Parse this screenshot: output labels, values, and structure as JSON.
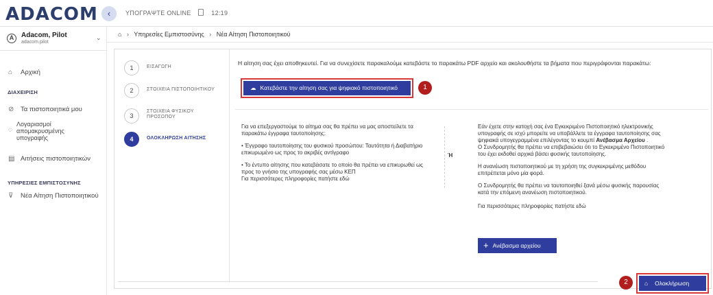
{
  "header": {
    "logo": "ADACOM",
    "collapse_icon": "chevron-left-icon",
    "collapse_glyph": "‹",
    "app_name": "ΥΠΟΓΡΑΨΤΕ ONLINE",
    "time": "12:19"
  },
  "user": {
    "name": "Adacom, Pilot",
    "login": "adacom.pilot",
    "avatar_glyph": "A"
  },
  "sidebar": {
    "home": "Αρχική",
    "section_manage": "ΔΙΑΧΕΙΡΙΣΗ",
    "my_certificates": "Τα πιστοποιητικά μου",
    "remote_accounts": "Λογαριασμοί απομακρυσμένης υπογραφής",
    "certificate_requests": "Αιτήσεις πιστοποιητικών",
    "section_trust": "ΥΠΗΡΕΣΙΕΣ ΕΜΠΙΣΤΟΣΥΝΗΣ",
    "new_request": "Νέα Αίτηση Πιστοποιητικού"
  },
  "breadcrumb": {
    "items": [
      "Υπηρεσίες Εμπιστοσύνης",
      "Νέα Αίτηση Πιστοποιητικού"
    ]
  },
  "steps": [
    {
      "num": "1",
      "label": "ΕΙΣΑΓΩΓΗ"
    },
    {
      "num": "2",
      "label": "ΣΤΟΙΧΕΙΑ ΠΙΣΤΟΠΟΙΗΤΙΚΟΥ"
    },
    {
      "num": "3",
      "label": "ΣΤΟΙΧΕΙΑ ΦΥΣΙΚΟΥ ΠΡΟΣΩΠΟΥ"
    },
    {
      "num": "4",
      "label": "ΟΛΟΚΛΗΡΩΣΗ ΑΙΤΗΣΗΣ"
    }
  ],
  "main": {
    "message": "Η αίτηση σας έχει αποθηκευτεί. Για να συνεχίσετε παρακαλούμε κατεβάστε το παρακάτω PDF αρχείο και ακολουθήστε τα βήματα που περιγράφονται παρακάτω:",
    "download_label": "Κατεβάστε την αίτηση σας για ψηφιακό πιστοποιητικό",
    "marker1": "1",
    "marker2": "2",
    "left_intro": "Για να επεξεργαστούμε το αίτημα σας θα πρέπει να μας αποστείλετε τα παρακάτω έγγραφα ταυτοποίησης:",
    "left_bullet1": "•  Έγγραφο ταυτοποίησης του φυσικού προσώπου: Ταυτότητα ή Διαβατήριο επικυρωμένο ως προς το ακριβές αντίγραφο",
    "left_bullet2": "•  Το έντυπο αίτησης που κατεβάσατε το οποίο θα πρέπει να επικυρωθεί ως προς το γνήσιο της υπογραφής σας μέσω ΚΕΠ",
    "left_more": "Για περισσότερες πληροφορίες πατήστε εδώ",
    "or": "Ή",
    "right_p1_a": "Εάν έχετε στην κατοχή σας ένα Εγκεκριμένο Πιστοποιητικό ηλεκτρονικής υπογραφής σε ισχύ μπορείτε να υποβάλλετε τα έγγραφα ταυτοποίησης σας ψηφιακά υπογεγραμμένα επιλέγοντας το κουμπί ",
    "right_p1_bold": "Ανέβασμα Αρχείου",
    "right_p1_c": " .",
    "right_p1_b": "Ο Συνδρομητής θα πρέπει να επιβεβαιώσει ότι το Εγκεκριμένο Πιστοποιητικό του έχει εκδοθεί αρχικά βάσει φυσικής ταυτοποίησης.",
    "right_p2": "Η ανανέωση πιστοποιητικού με τη χρήση της συγκεκριμένης μεθόδου επιτρέπεται μόνο μία φορά.",
    "right_p3": "Ο Συνδρομητής θα πρέπει να ταυτοποιηθεί ξανά μέσω φυσικής παρουσίας κατά την επόμενη ανανέωση πιστοποιητικού.",
    "right_more": "Για περισσότερες πληροφορίες πατήστε εδώ",
    "upload_label": "Ανέβασμα αρχείου",
    "finish_label": "Ολοκλήρωση"
  },
  "colors": {
    "primary": "#2f3e9e",
    "highlight": "#d93737",
    "marker": "#b21e1e"
  }
}
